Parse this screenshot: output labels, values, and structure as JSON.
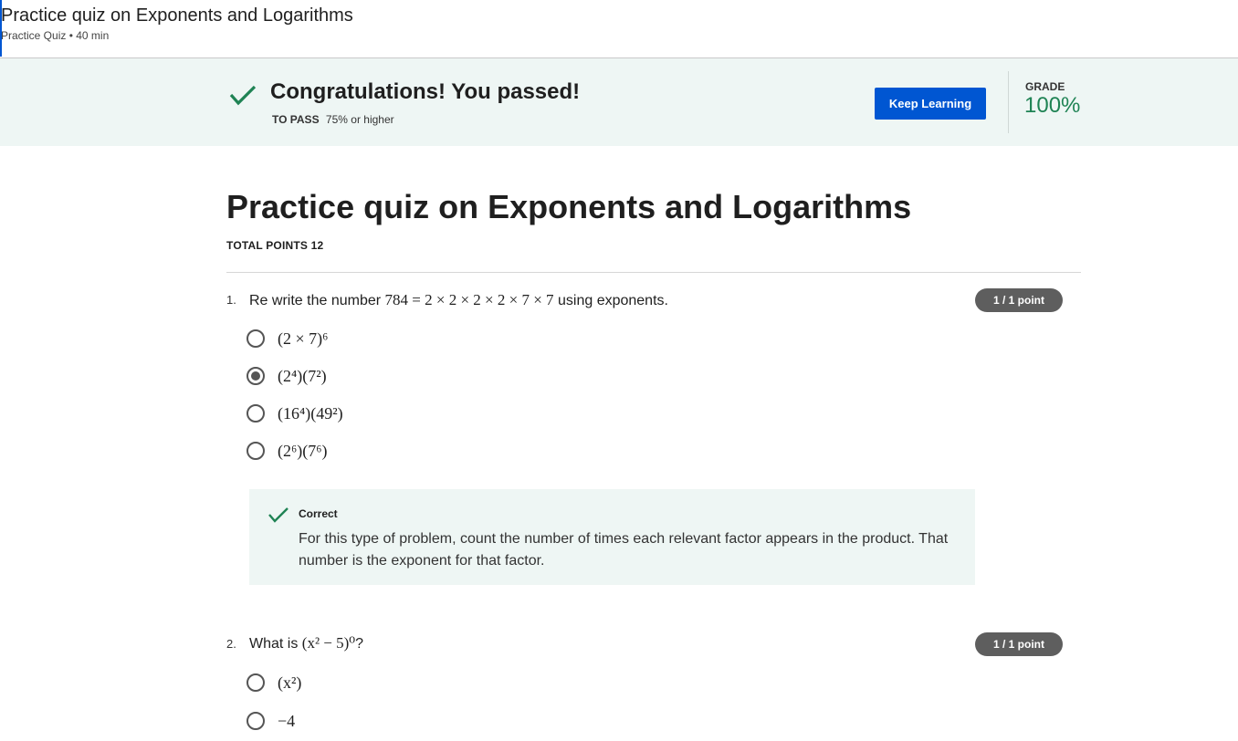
{
  "header": {
    "title": "Practice quiz on Exponents and Logarithms",
    "subtitle": "Practice Quiz • 40 min"
  },
  "banner": {
    "message": "Congratulations! You passed!",
    "to_pass_label": "TO PASS",
    "to_pass_value": "75% or higher",
    "keep_learning": "Keep Learning",
    "grade_label": "GRADE",
    "grade_value": "100%",
    "accent_color": "#1f8354",
    "button_color": "#0056d2"
  },
  "quiz": {
    "title": "Practice quiz on Exponents and Logarithms",
    "total_points": "TOTAL POINTS 12",
    "questions": [
      {
        "number": "1.",
        "text_before": "Re write the number ",
        "math": "784 = 2 × 2 × 2 × 2 × 7 × 7",
        "text_after": " using exponents.",
        "points": "1 / 1 point",
        "options": [
          {
            "label": "(2 × 7)⁶",
            "selected": false
          },
          {
            "label": "(2⁴)(7²)",
            "selected": true
          },
          {
            "label": "(16⁴)(49²)",
            "selected": false
          },
          {
            "label": "(2⁶)(7⁶)",
            "selected": false
          }
        ],
        "feedback": {
          "title": "Correct",
          "body": "For this type of problem, count the number of times each relevant factor appears in the product. That number is the exponent for that factor."
        }
      },
      {
        "number": "2.",
        "text_before": "What is ",
        "math": "(x² − 5)⁰",
        "text_after": "?",
        "points": "1 / 1 point",
        "options": [
          {
            "label": "(x²)",
            "selected": false
          },
          {
            "label": "−4",
            "selected": false
          }
        ]
      }
    ]
  }
}
